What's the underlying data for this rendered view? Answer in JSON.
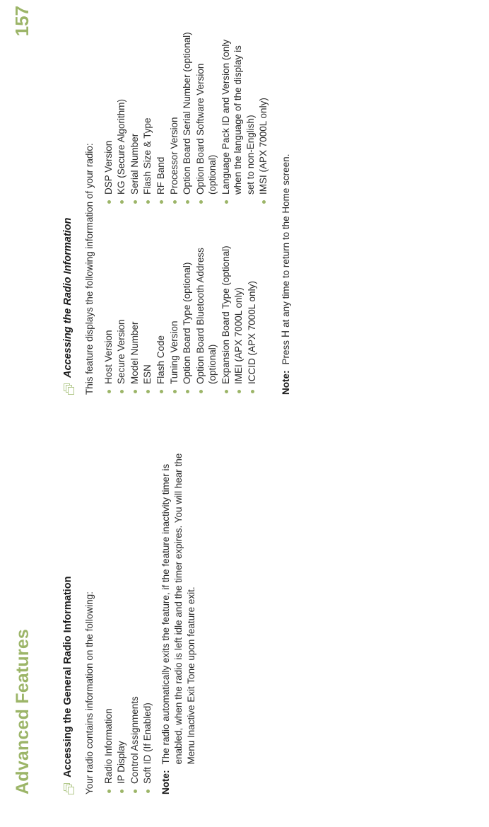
{
  "header": {
    "title": "Advanced Features",
    "page_number": "157",
    "accent_color": "#9cb568"
  },
  "left_column": {
    "section": {
      "icon": "stacked-pages-icon",
      "title": "Accessing the General Radio Information"
    },
    "intro": "Your radio contains information on the following:",
    "bullets": [
      "Radio Information",
      "IP Display",
      "Control Assignments",
      "Soft ID (If Enabled)"
    ],
    "note": {
      "label": "Note:",
      "text": "The radio automatically exits the feature, if the feature inactivity timer is enabled, when the radio is left idle and the timer expires. You will hear the Menu Inactive Exit Tone upon feature exit."
    }
  },
  "right_column": {
    "section": {
      "icon": "stacked-pages-icon",
      "title": "Accessing the Radio Information"
    },
    "intro": "This feature displays the following information of your radio:",
    "bullets_col1": [
      "Host Version",
      "Secure Version",
      "Model Number",
      "ESN",
      "Flash Code",
      "Tuning Version",
      "Option Board Type (optional)",
      "Option Board Bluetooth Address (optional)",
      "Expansion Board Type (optional)",
      "IMEI (APX 7000L only)",
      "ICCID (APX 7000L only)"
    ],
    "bullets_col2": [
      "DSP Version",
      "KG (Secure Algorithm)",
      "Serial Number",
      "Flash Size & Type",
      "RF Band",
      "Processor Version",
      "Option Board Serial Number (optional)",
      "Option Board Software Version (optional)",
      "Language Pack ID and Version (only when the language of the display is set to non-English)",
      "IMSI (APX 7000L only)"
    ],
    "note": {
      "label": "Note:",
      "text_before": "Press",
      "key_glyph": "H",
      "text_after": "at any time to return to the Home screen."
    }
  }
}
